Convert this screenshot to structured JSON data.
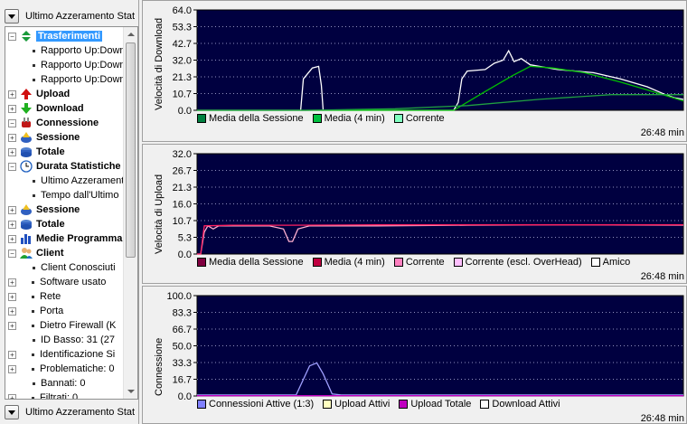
{
  "top_dropdown": {
    "label": "Ultimo Azzeramento Stat"
  },
  "bottom_dropdown": {
    "label": "Ultimo Azzeramento Stat"
  },
  "tree": [
    {
      "label": "Trasferimenti",
      "level": 0,
      "kind": "root",
      "icon": "updown-arrow-icon",
      "bold": true,
      "selected": true,
      "expander": "−"
    },
    {
      "label": "Rapporto Up:Down",
      "level": 2,
      "kind": "leaf"
    },
    {
      "label": "Rapporto Up:Down",
      "level": 2,
      "kind": "leaf"
    },
    {
      "label": "Rapporto Up:Down",
      "level": 2,
      "kind": "leaf"
    },
    {
      "label": "Upload",
      "level": 1,
      "kind": "node",
      "icon": "red-up-arrow-icon",
      "bold": true,
      "expander": "+"
    },
    {
      "label": "Download",
      "level": 1,
      "kind": "node",
      "icon": "green-down-arrow-icon",
      "bold": true,
      "expander": "+"
    },
    {
      "label": "Connessione",
      "level": 0,
      "kind": "root",
      "icon": "plug-icon",
      "bold": true,
      "expander": "−"
    },
    {
      "label": "Sessione",
      "level": 1,
      "kind": "node",
      "icon": "session-icon",
      "bold": true,
      "expander": "+"
    },
    {
      "label": "Totale",
      "level": 1,
      "kind": "node",
      "icon": "total-icon",
      "bold": true,
      "expander": "+"
    },
    {
      "label": "Durata Statistiche",
      "level": 0,
      "kind": "root",
      "icon": "clock-icon",
      "bold": true,
      "expander": "−"
    },
    {
      "label": "Ultimo Azzeramento",
      "level": 2,
      "kind": "leaf"
    },
    {
      "label": "Tempo dall'Ultimo",
      "level": 2,
      "kind": "leaf"
    },
    {
      "label": "Sessione",
      "level": 1,
      "kind": "node",
      "icon": "session-icon",
      "bold": true,
      "expander": "+"
    },
    {
      "label": "Totale",
      "level": 1,
      "kind": "node",
      "icon": "total-icon",
      "bold": true,
      "expander": "+"
    },
    {
      "label": "Medie Programma",
      "level": 1,
      "kind": "node",
      "icon": "bars-icon",
      "bold": true,
      "expander": "+"
    },
    {
      "label": "Client",
      "level": 0,
      "kind": "root",
      "icon": "users-icon",
      "bold": true,
      "expander": "−"
    },
    {
      "label": "Client Conosciuti",
      "level": 2,
      "kind": "leaf"
    },
    {
      "label": "Software usato",
      "level": 1,
      "kind": "nodeplain",
      "expander": "+"
    },
    {
      "label": "Rete",
      "level": 1,
      "kind": "nodeplain",
      "expander": "+"
    },
    {
      "label": "Porta",
      "level": 1,
      "kind": "nodeplain",
      "expander": "+"
    },
    {
      "label": "Dietro Firewall (K",
      "level": 1,
      "kind": "nodeplain",
      "expander": "+"
    },
    {
      "label": "ID Basso: 31 (27",
      "level": 2,
      "kind": "leaf"
    },
    {
      "label": "Identificazione Si",
      "level": 1,
      "kind": "nodeplain",
      "expander": "+"
    },
    {
      "label": "Problematiche: 0",
      "level": 1,
      "kind": "nodeplain",
      "expander": "+"
    },
    {
      "label": "Bannati: 0",
      "level": 2,
      "kind": "leaf"
    },
    {
      "label": "Filtrati: 0",
      "level": 1,
      "kind": "nodeplain",
      "expander": "+"
    }
  ],
  "charts": [
    {
      "ylabel": "Velocità di Download",
      "ticks": [
        "64.0",
        "53.3",
        "42.7",
        "32.0",
        "21.3",
        "10.7",
        "0.0"
      ],
      "ymax": 64,
      "time": "26:48 min",
      "legend": [
        {
          "label": "Media della Sessione",
          "color": "#008040"
        },
        {
          "label": "Media (4 min)",
          "color": "#00c040"
        },
        {
          "label": "Corrente",
          "color": "#80ffc0"
        }
      ],
      "series": [
        {
          "color": "#ffffff",
          "points": [
            [
              0,
              0
            ],
            [
              115,
              0
            ],
            [
              118,
              20
            ],
            [
              128,
              27
            ],
            [
              135,
              28
            ],
            [
              138,
              16
            ],
            [
              140,
              0
            ],
            [
              285,
              0
            ],
            [
              290,
              5
            ],
            [
              294,
              20
            ],
            [
              300,
              25
            ],
            [
              320,
              26
            ],
            [
              330,
              30
            ],
            [
              340,
              32
            ],
            [
              346,
              38
            ],
            [
              352,
              31
            ],
            [
              360,
              33
            ],
            [
              370,
              29
            ],
            [
              380,
              28
            ],
            [
              400,
              26
            ],
            [
              420,
              25
            ],
            [
              440,
              24
            ],
            [
              470,
              20
            ],
            [
              500,
              15
            ],
            [
              520,
              10
            ],
            [
              530,
              8
            ],
            [
              540,
              7
            ]
          ]
        },
        {
          "color": "#00c000",
          "points": [
            [
              0,
              0
            ],
            [
              285,
              0
            ],
            [
              320,
              12
            ],
            [
              350,
              22
            ],
            [
              370,
              28
            ],
            [
              395,
              27
            ],
            [
              430,
              24
            ],
            [
              470,
              18
            ],
            [
              500,
              13
            ],
            [
              540,
              6
            ]
          ]
        },
        {
          "color": "#20a040",
          "points": [
            [
              0,
              0
            ],
            [
              120,
              0
            ],
            [
              220,
              1
            ],
            [
              300,
              3
            ],
            [
              380,
              7
            ],
            [
              460,
              10
            ],
            [
              540,
              10
            ]
          ]
        }
      ]
    },
    {
      "ylabel": "Velocità di Upload",
      "ticks": [
        "32.0",
        "26.7",
        "21.3",
        "16.0",
        "10.7",
        "5.3",
        "0.0"
      ],
      "ymax": 32,
      "time": "26:48 min",
      "legend": [
        {
          "label": "Media della Sessione",
          "color": "#800040"
        },
        {
          "label": "Media (4 min)",
          "color": "#c00040"
        },
        {
          "label": "Corrente",
          "color": "#ff80c0"
        },
        {
          "label": "Corrente (escl. OverHead)",
          "color": "#ffc0ff"
        },
        {
          "label": "Amico",
          "color": "#ffffff"
        }
      ],
      "series": [
        {
          "color": "#ffb0d0",
          "points": [
            [
              0,
              0
            ],
            [
              4,
              0
            ],
            [
              8,
              7
            ],
            [
              12,
              9
            ],
            [
              18,
              8
            ],
            [
              24,
              9
            ],
            [
              35,
              9
            ],
            [
              60,
              9
            ],
            [
              80,
              9
            ],
            [
              96,
              8
            ],
            [
              102,
              4
            ],
            [
              106,
              4
            ],
            [
              112,
              8
            ],
            [
              125,
              9
            ],
            [
              200,
              9
            ],
            [
              300,
              9.2
            ],
            [
              400,
              9.3
            ],
            [
              540,
              9.2
            ]
          ]
        },
        {
          "color": "#ff2060",
          "points": [
            [
              0,
              0
            ],
            [
              4,
              0
            ],
            [
              8,
              9
            ],
            [
              40,
              9.2
            ],
            [
              100,
              9.2
            ],
            [
              200,
              9.3
            ],
            [
              540,
              9.3
            ]
          ]
        }
      ]
    },
    {
      "ylabel": "Connessione",
      "ticks": [
        "100.0",
        "83.3",
        "66.7",
        "50.0",
        "33.3",
        "16.7",
        "0.0"
      ],
      "ymax": 100,
      "time": "26:48 min",
      "legend": [
        {
          "label": "Connessioni Attive (1:3)",
          "color": "#8080ff"
        },
        {
          "label": "Upload Attivi",
          "color": "#ffffc0"
        },
        {
          "label": "Upload Totale",
          "color": "#c000c0"
        },
        {
          "label": "Download Attivi",
          "color": "#ffffff"
        }
      ],
      "series": [
        {
          "color": "#a0a0ff",
          "points": [
            [
              0,
              1
            ],
            [
              110,
              1
            ],
            [
              125,
              30
            ],
            [
              133,
              33
            ],
            [
              140,
              22
            ],
            [
              150,
              2
            ],
            [
              160,
              1
            ],
            [
              540,
              1
            ]
          ]
        },
        {
          "color": "#c000c0",
          "points": [
            [
              0,
              0.3
            ],
            [
              540,
              0.3
            ]
          ]
        }
      ]
    }
  ]
}
